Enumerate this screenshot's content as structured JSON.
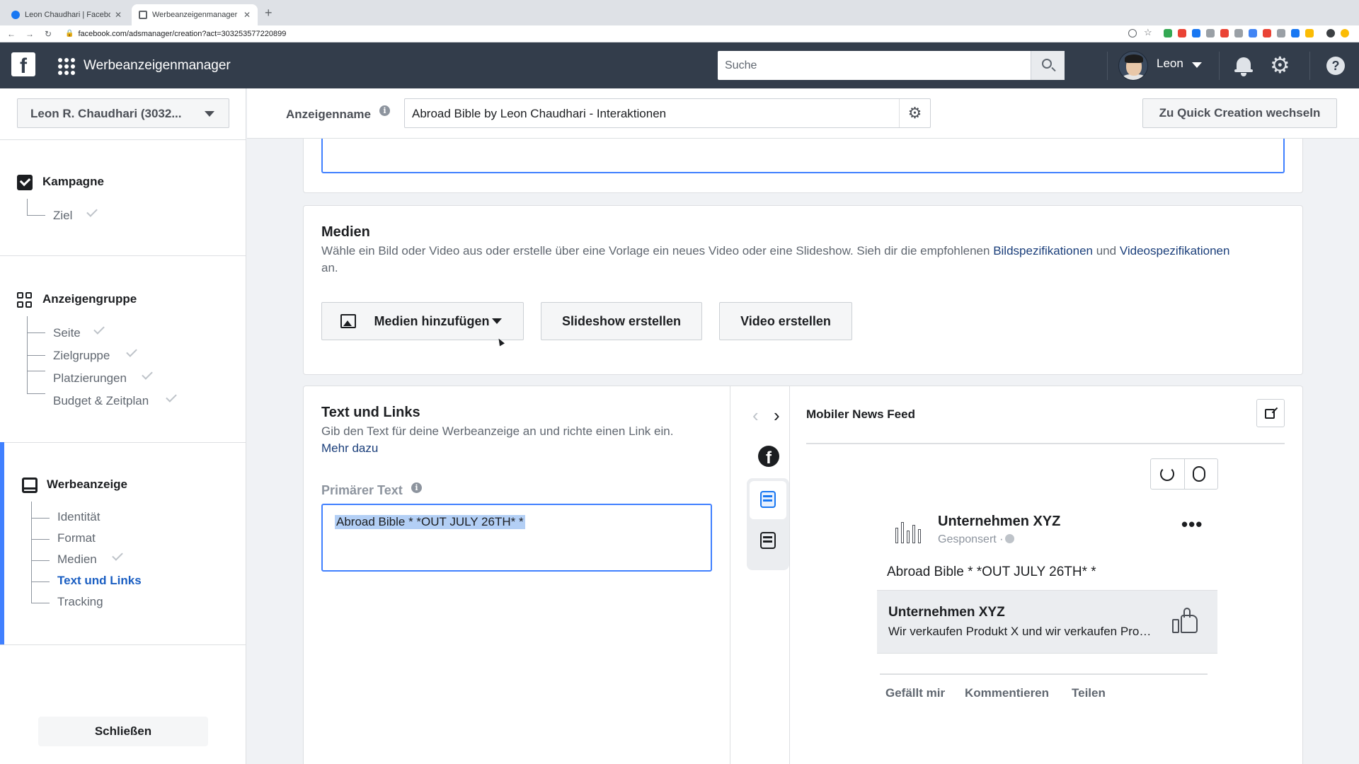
{
  "browser": {
    "tabs": [
      {
        "title": "Leon Chaudhari | Facebook"
      },
      {
        "title": "Werbeanzeigenmanager - Cre"
      }
    ],
    "new_tab": "+",
    "url": "facebook.com/adsmanager/creation?act=303253577220899",
    "extension_colors": [
      "#34a853",
      "#ea4335",
      "#1877f2",
      "#9aa0a6",
      "#ea4335",
      "#9aa0a6",
      "#4285f4",
      "#ea4335",
      "#9aa0a6",
      "#1877f2",
      "#fbbc04"
    ]
  },
  "topbar": {
    "app_title": "Werbeanzeigenmanager",
    "search_placeholder": "Suche",
    "user_name": "Leon",
    "icons": [
      "grid-menu-icon",
      "search-icon",
      "bell-icon",
      "gear-icon",
      "help-icon"
    ],
    "colors": {
      "bar": "#333d4b",
      "accent": "#4080ff",
      "link": "#1a5ec2"
    }
  },
  "sidebar": {
    "account": "Leon R. Chaudhari (3032...",
    "sections": [
      {
        "title": "Kampagne",
        "items": [
          {
            "label": "Ziel",
            "done": true
          }
        ]
      },
      {
        "title": "Anzeigengruppe",
        "items": [
          {
            "label": "Seite",
            "done": true
          },
          {
            "label": "Zielgruppe",
            "done": true
          },
          {
            "label": "Platzierungen",
            "done": true
          },
          {
            "label": "Budget & Zeitplan",
            "done": true
          }
        ]
      },
      {
        "title": "Werbeanzeige",
        "items": [
          {
            "label": "Identität",
            "done": false
          },
          {
            "label": "Format",
            "done": false
          },
          {
            "label": "Medien",
            "done": true
          },
          {
            "label": "Text und Links",
            "done": false,
            "active": true
          },
          {
            "label": "Tracking",
            "done": false
          }
        ]
      }
    ],
    "close_label": "Schließen"
  },
  "header": {
    "ad_name_label": "Anzeigenname",
    "ad_name_value": "Abroad Bible by Leon Chaudhari - Interaktionen",
    "quick_creation_label": "Zu Quick Creation wechseln"
  },
  "media": {
    "title": "Medien",
    "desc_pre": "Wähle ein Bild oder Video aus oder erstelle über eine Vorlage ein neues Video oder eine Slideshow. Sieh dir die empfohlenen ",
    "link1": "Bildspezifikationen",
    "desc_mid": " und ",
    "link2": "Videospezifikationen",
    "desc_post": "an.",
    "add_media": "Medien hinzufügen",
    "slideshow": "Slideshow erstellen",
    "video": "Video erstellen"
  },
  "text_links": {
    "title": "Text und Links",
    "desc": "Gib den Text für deine Werbeanzeige an und richte einen Link ein.",
    "more": "Mehr dazu",
    "primary_label": "Primärer Text",
    "primary_value": "Abroad Bible * *OUT JULY 26TH* *"
  },
  "preview": {
    "title": "Mobiler News Feed",
    "page_name": "Unternehmen XYZ",
    "sponsored": "Gesponsert ·",
    "post_text": "Abroad Bible * *OUT JULY 26TH* *",
    "link_title": "Unternehmen XYZ",
    "link_desc": "Wir verkaufen Produkt X und wir verkaufen Produkt Y",
    "actions": [
      "Gefällt mir",
      "Kommentieren",
      "Teilen"
    ]
  }
}
